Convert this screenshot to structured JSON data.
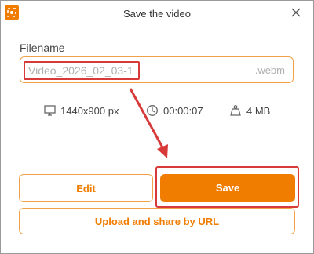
{
  "window": {
    "title": "Save the video"
  },
  "filename": {
    "label": "Filename",
    "value": "Video_2026_02_03-1",
    "extension": ".webm"
  },
  "meta": {
    "resolution": "1440x900 px",
    "duration": "00:00:07",
    "size": "4 MB"
  },
  "buttons": {
    "edit": "Edit",
    "save": "Save",
    "upload": "Upload and share by URL"
  },
  "colors": {
    "accent": "#f07d00",
    "highlight": "#d83a3a"
  },
  "icons": [
    "app-logo-icon",
    "close-icon",
    "monitor-icon",
    "clock-icon",
    "weight-icon"
  ]
}
